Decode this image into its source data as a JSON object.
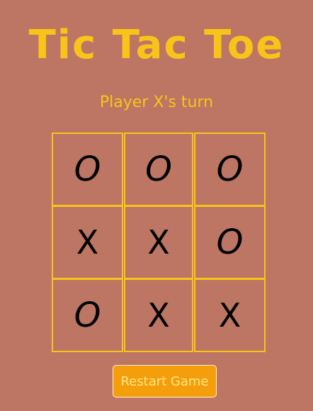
{
  "game": {
    "title": "Tic Tac Toe",
    "status": "Player X's turn",
    "board": [
      [
        "O",
        "O",
        "O"
      ],
      [
        "X",
        "X",
        "O"
      ],
      [
        "O",
        "X",
        "X"
      ]
    ],
    "restart_label": "Restart Game"
  },
  "colors": {
    "background": "#bd7663",
    "accent": "#f9c41a",
    "button_background": "#f59e0b",
    "button_text": "#fde68a",
    "mark": "#000000"
  }
}
